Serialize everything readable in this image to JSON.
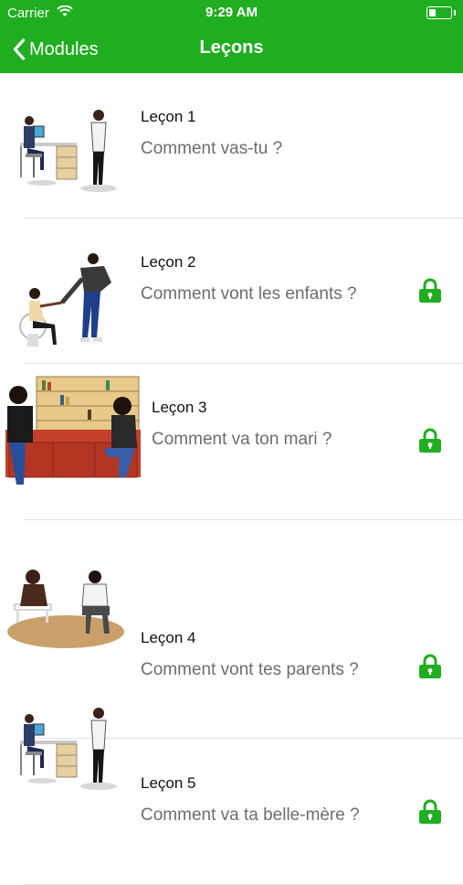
{
  "status": {
    "carrier": "Carrier",
    "time": "9:29 AM"
  },
  "nav": {
    "back_label": "Modules",
    "title": "Leçons"
  },
  "lessons": [
    {
      "title": "Leçon 1",
      "subtitle": "Comment vas-tu ?",
      "locked": false,
      "image": "office-scene"
    },
    {
      "title": "Leçon 2",
      "subtitle": "Comment vont les enfants ?",
      "locked": true,
      "image": "greeting-scene"
    },
    {
      "title": "Leçon 3",
      "subtitle": "Comment va ton mari ?",
      "locked": true,
      "image": "living-room-scene"
    },
    {
      "title": "Leçon 4",
      "subtitle": "Comment vont tes parents ?",
      "locked": true,
      "image": "sitting-scene"
    },
    {
      "title": "Leçon 5",
      "subtitle": "Comment va ta belle-mère ?",
      "locked": true,
      "image": "office-scene"
    }
  ],
  "colors": {
    "brand": "#1fae1f",
    "lock": "#1fae1f"
  }
}
